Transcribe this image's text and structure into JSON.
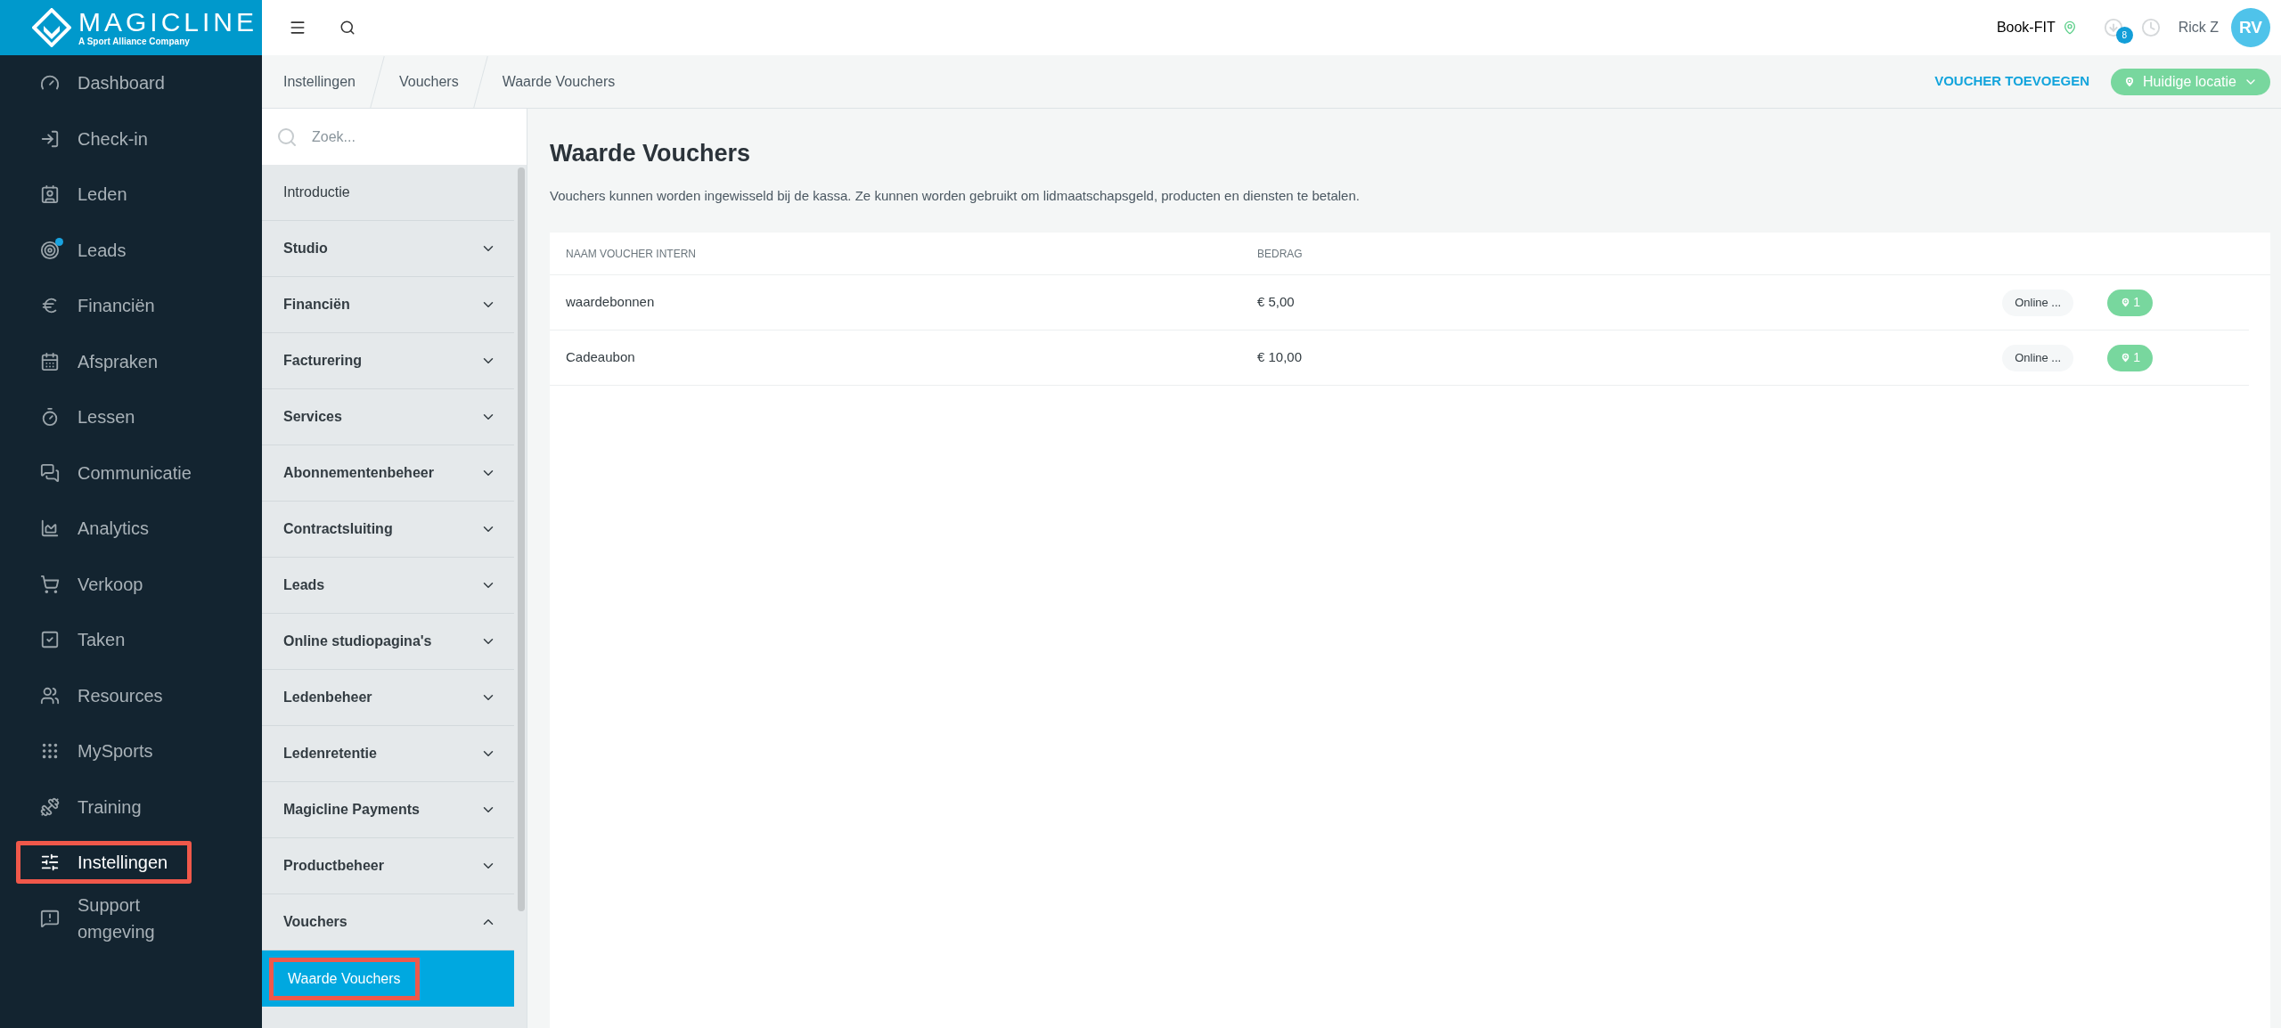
{
  "brand": {
    "name": "MAGICLINE",
    "tagline": "A Sport Alliance Company"
  },
  "nav": [
    {
      "label": "Dashboard",
      "selected": false,
      "highlighted": false,
      "dot": false
    },
    {
      "label": "Check-in",
      "selected": false,
      "highlighted": false,
      "dot": false
    },
    {
      "label": "Leden",
      "selected": false,
      "highlighted": false,
      "dot": false
    },
    {
      "label": "Leads",
      "selected": false,
      "highlighted": false,
      "dot": true
    },
    {
      "label": "Financiën",
      "selected": false,
      "highlighted": false,
      "dot": false
    },
    {
      "label": "Afspraken",
      "selected": false,
      "highlighted": false,
      "dot": false
    },
    {
      "label": "Lessen",
      "selected": false,
      "highlighted": false,
      "dot": false
    },
    {
      "label": "Communicatie",
      "selected": false,
      "highlighted": false,
      "dot": false
    },
    {
      "label": "Analytics",
      "selected": false,
      "highlighted": false,
      "dot": false
    },
    {
      "label": "Verkoop",
      "selected": false,
      "highlighted": false,
      "dot": false
    },
    {
      "label": "Taken",
      "selected": false,
      "highlighted": false,
      "dot": false
    },
    {
      "label": "Resources",
      "selected": false,
      "highlighted": false,
      "dot": false
    },
    {
      "label": "MySports",
      "selected": false,
      "highlighted": false,
      "dot": false
    },
    {
      "label": "Training",
      "selected": false,
      "highlighted": false,
      "dot": false
    },
    {
      "label": "Instellingen",
      "selected": true,
      "highlighted": true,
      "dot": false
    },
    {
      "label": "Support omgeving",
      "selected": false,
      "highlighted": false,
      "dot": false
    }
  ],
  "topbar": {
    "studio": "Book-FIT",
    "downloads_badge": "8",
    "user": "Rick Z",
    "avatar": "RV"
  },
  "breadcrumbs": [
    "Instellingen",
    "Vouchers",
    "Waarde Vouchers"
  ],
  "actions": {
    "add": "VOUCHER TOEVOEGEN",
    "location": "Huidige locatie"
  },
  "settings_menu": {
    "search_placeholder": "Zoek...",
    "items": [
      {
        "label": "Introductie",
        "kind": "link"
      },
      {
        "label": "Studio",
        "kind": "group",
        "expanded": false
      },
      {
        "label": "Financiën",
        "kind": "group",
        "expanded": false
      },
      {
        "label": "Facturering",
        "kind": "group",
        "expanded": false
      },
      {
        "label": "Services",
        "kind": "group",
        "expanded": false
      },
      {
        "label": "Abonnementenbeheer",
        "kind": "group",
        "expanded": false
      },
      {
        "label": "Contractsluiting",
        "kind": "group",
        "expanded": false
      },
      {
        "label": "Leads",
        "kind": "group",
        "expanded": false
      },
      {
        "label": "Online studiopagina's",
        "kind": "group",
        "expanded": false
      },
      {
        "label": "Ledenbeheer",
        "kind": "group",
        "expanded": false
      },
      {
        "label": "Ledenretentie",
        "kind": "group",
        "expanded": false
      },
      {
        "label": "Magicline Payments",
        "kind": "group",
        "expanded": false
      },
      {
        "label": "Productbeheer",
        "kind": "group",
        "expanded": false
      },
      {
        "label": "Vouchers",
        "kind": "group",
        "expanded": true,
        "children": [
          {
            "label": "Waarde Vouchers",
            "selected": true,
            "highlighted": true
          }
        ]
      }
    ]
  },
  "page": {
    "title": "Waarde Vouchers",
    "description": "Vouchers kunnen worden ingewisseld bij de kassa. Ze kunnen worden gebruikt om lidmaatschapsgeld, producten en diensten te betalen."
  },
  "table": {
    "columns": [
      "NAAM VOUCHER INTERN",
      "BEDRAG"
    ],
    "rows": [
      {
        "name": "waardebonnen",
        "amount": "€ 5,00",
        "channel": "Online ...",
        "locations": "1"
      },
      {
        "name": "Cadeaubon",
        "amount": "€ 10,00",
        "channel": "Online ...",
        "locations": "1"
      }
    ]
  }
}
